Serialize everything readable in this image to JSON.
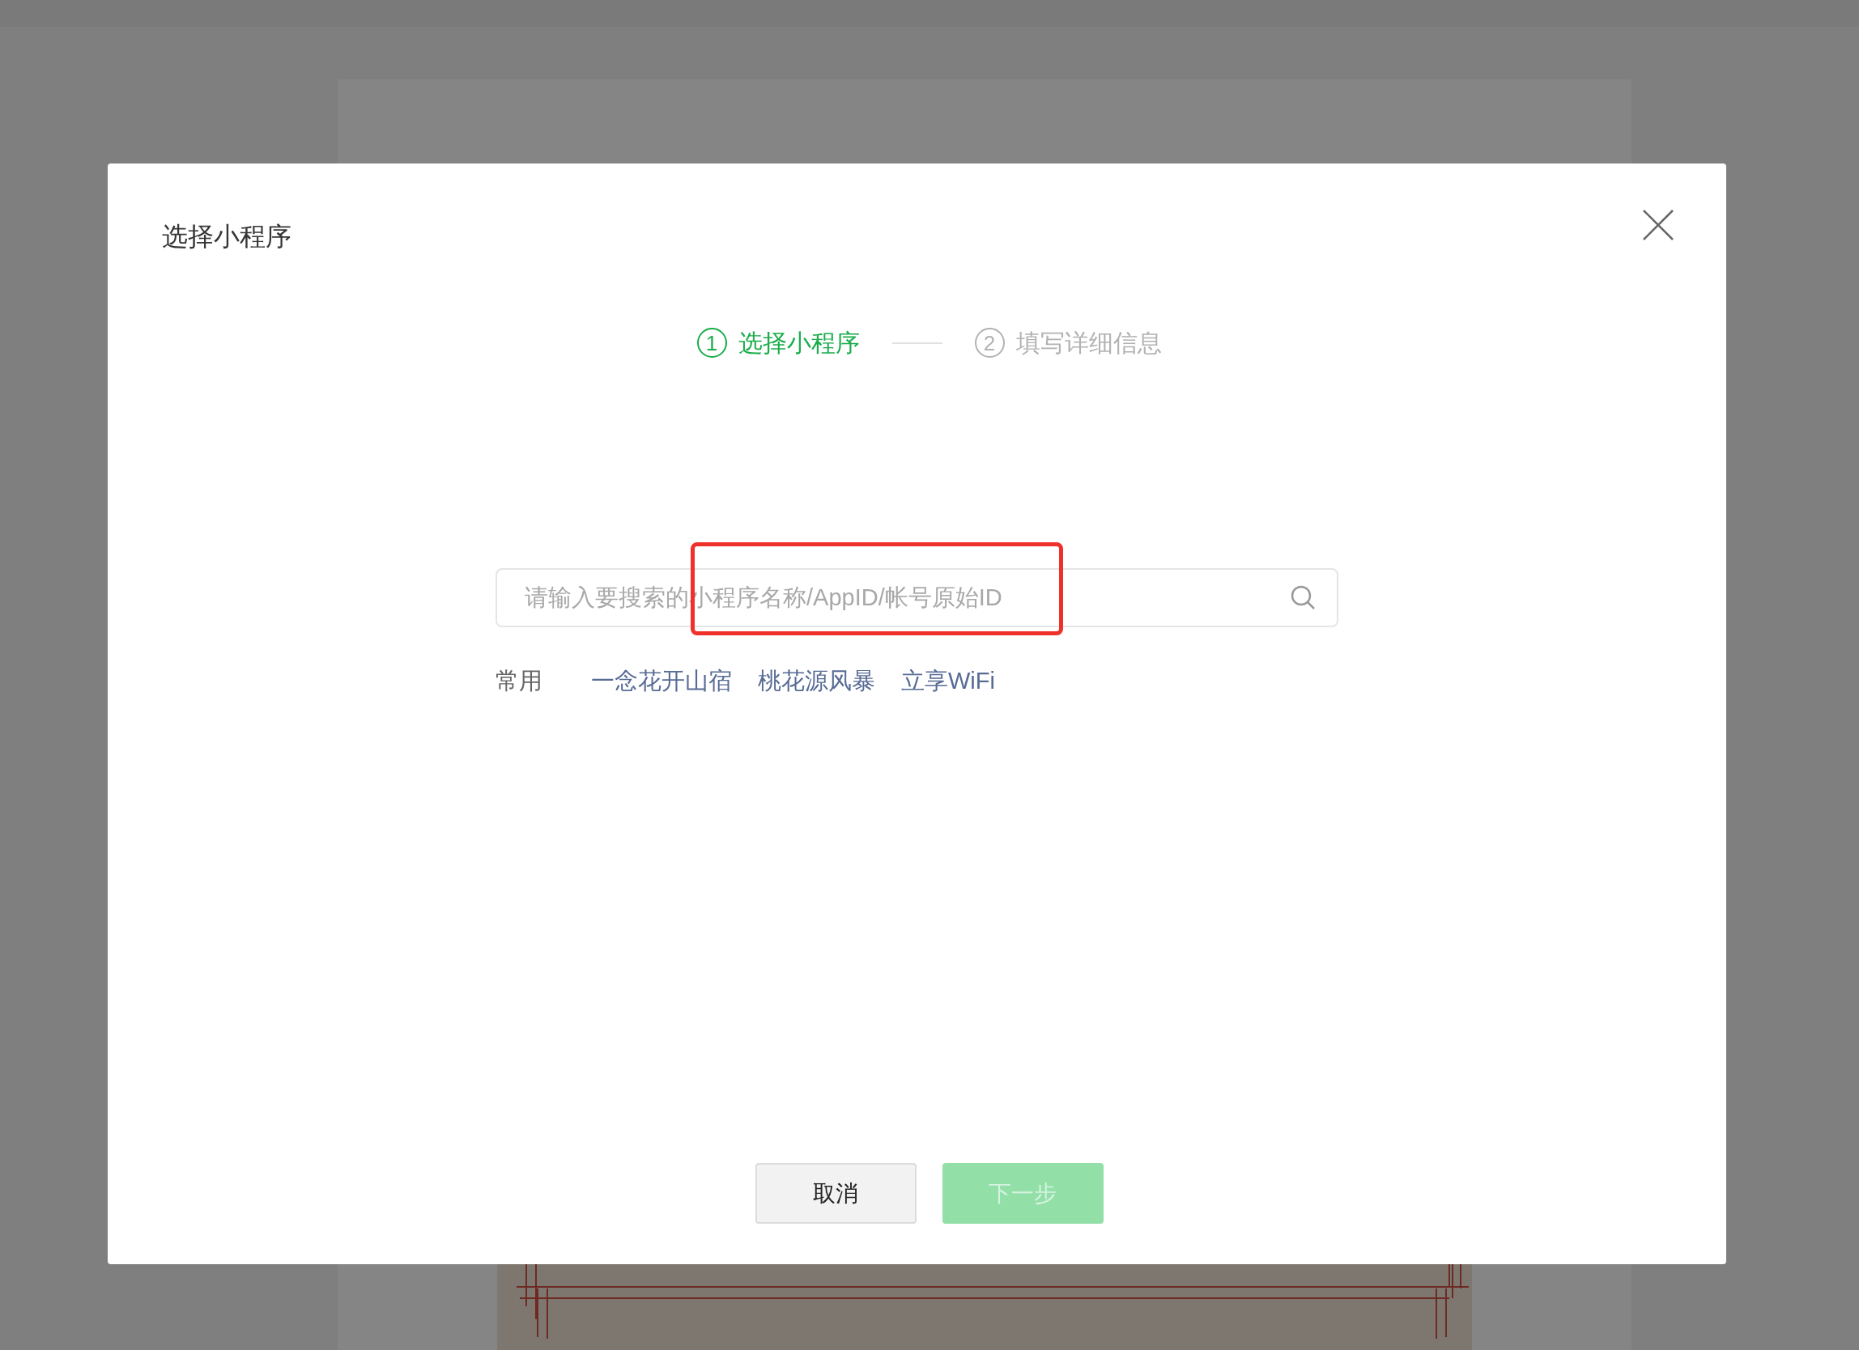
{
  "dialog": {
    "title": "选择小程序"
  },
  "steps": [
    {
      "number": "1",
      "label": "选择小程序",
      "selected": true
    },
    {
      "number": "2",
      "label": "填写详细信息",
      "selected": false
    }
  ],
  "search": {
    "placeholder": "请输入要搜索的小程序名称/AppID/帐号原始ID"
  },
  "recent": {
    "label": "常用",
    "items": [
      "一念花开山宿",
      "桃花源风暴",
      "立享WiFi"
    ]
  },
  "buttons": [
    {
      "label": "取消",
      "kind": "secondary",
      "disabled": false
    },
    {
      "label": "下一步",
      "kind": "primary",
      "disabled": true
    }
  ]
}
